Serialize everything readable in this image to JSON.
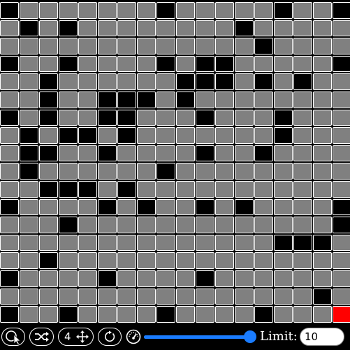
{
  "board": {
    "rows": 18,
    "cols": 18,
    "cells": [
      "bgggggggbgggggbggb",
      "gbgbggggggggbggggg",
      "gggggggggggggbgggg",
      "bggbggggbgbbgggggb",
      "ggbggggggbbbgbgbgg",
      "ggbggbbbgbgggggggg",
      "bgbggbbgggbgggbggg",
      "gbgbbgbgggggggbggg",
      "gbbggbggggbggbgggg",
      "gbggggggbggggggggg",
      "ggbbbgbggggggggggg",
      "bggggbgbggbgbggggb",
      "gggbgggggggggggggb",
      "ggggggggggggggbbbg",
      "ggbggggggggggggggg",
      "bggggbggggbggggggg",
      "ggggggggggggggggbg",
      "bggbggggbggggbgggr"
    ],
    "colors": {
      "empty": "#808080",
      "wall": "#000000",
      "goal": "#ff0000"
    }
  },
  "toolbar": {
    "select_icon": "circle-cursor-icon",
    "shuffle_icon": "shuffle-icon",
    "moves_count": "4",
    "move_icon": "move-arrows-icon",
    "reset_icon": "rotate-icon",
    "speed_icon": "speedometer-icon",
    "speed_level": 1.0,
    "accent": "#1a7cff",
    "limit_label": "Limit:",
    "limit_value": "10"
  }
}
